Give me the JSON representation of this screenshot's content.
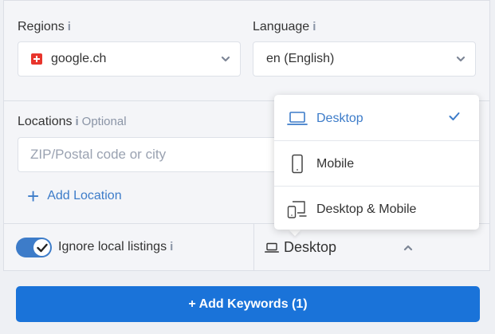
{
  "regions": {
    "label": "Regions",
    "info": "i",
    "value": "google.ch",
    "flag_icon": "swiss-flag-icon"
  },
  "language": {
    "label": "Language",
    "info": "i",
    "value": "en (English)"
  },
  "locations": {
    "label": "Locations",
    "info": "i",
    "optional": "Optional",
    "placeholder": "ZIP/Postal code or city",
    "add_label": "Add Location",
    "add_icon": "plus-icon"
  },
  "ignore_local": {
    "label": "Ignore local listings",
    "info": "i",
    "enabled": true
  },
  "device": {
    "selected": "Desktop",
    "options": [
      {
        "label": "Desktop",
        "icon": "laptop-icon",
        "selected": true
      },
      {
        "label": "Mobile",
        "icon": "mobile-icon",
        "selected": false
      },
      {
        "label": "Desktop & Mobile",
        "icon": "desktop-mobile-icon",
        "selected": false
      }
    ]
  },
  "add_keywords": {
    "label": "+ Add Keywords (1)"
  },
  "colors": {
    "accent": "#3d7cc9",
    "primary_button": "#1a73d9",
    "flag_red": "#e8352c"
  }
}
